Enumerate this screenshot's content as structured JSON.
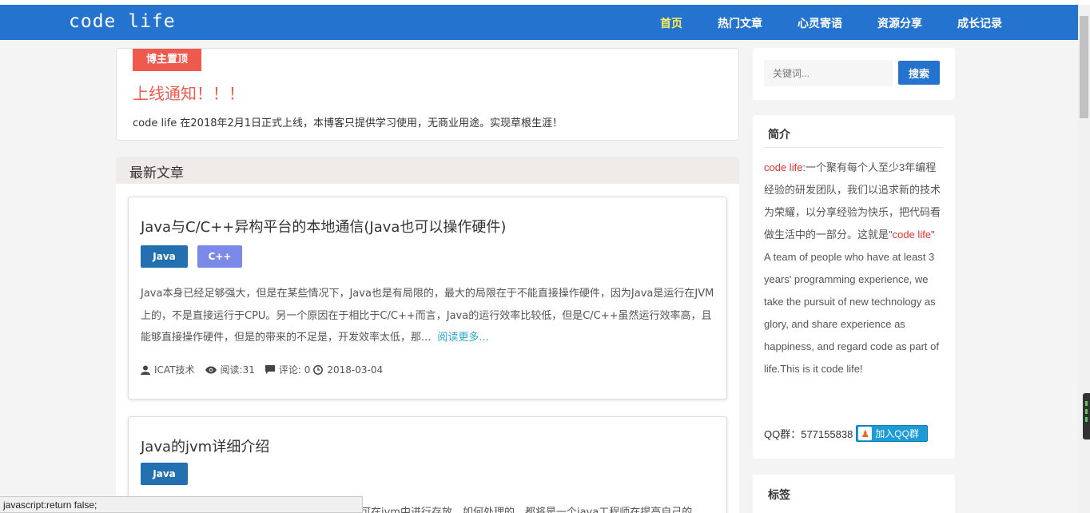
{
  "header": {
    "logo": "code life",
    "nav": [
      {
        "label": "首页",
        "active": true
      },
      {
        "label": "热门文章",
        "active": false
      },
      {
        "label": "心灵寄语",
        "active": false
      },
      {
        "label": "资源分享",
        "active": false
      },
      {
        "label": "成长记录",
        "active": false
      }
    ],
    "colors": {
      "bar": "#2373cf",
      "active": "#ffec5c"
    }
  },
  "pinned": {
    "tag": "博主置顶",
    "title": "上线通知！！！",
    "text": "code life 在2018年2月1日正式上线，本博客只提供学习使用，无商业用途。实现草根生涯！"
  },
  "latest": {
    "heading": "最新文章",
    "posts": [
      {
        "title": "Java与C/C++异构平台的本地通信(Java也可以操作硬件)",
        "tags": [
          "Java",
          "C++"
        ],
        "excerpt": "Java本身已经足够强大，但是在某些情况下，Java也是有局限的，最大的局限在于不能直接操作硬件，因为Java是运行在JVM上的，不是直接运行于CPU。另一个原因在于相比于C/C++而言，Java的运行效率比较低，但是C/C++虽然运行效率高，且能够直接操作硬件，但是的带来的不足是，开发效率太低，那...",
        "read_more": "阅读更多...",
        "author": "ICAT技术",
        "views": "阅读:31",
        "comments": "评论: 0",
        "date": "2018-03-04"
      },
      {
        "title": "Java的jvm详细介绍",
        "tags": [
          "Java"
        ],
        "excerpt_partial": "可在jvm中进行存放，如何处理的，都将是一个java工程师在提高自己的"
      }
    ]
  },
  "sidebar": {
    "search": {
      "placeholder": "关键词...",
      "button": "搜索"
    },
    "intro": {
      "title": "简介",
      "brand": "code life",
      "text_cn": ":一个聚有每个人至少3年编程经验的研发团队，我们以追求新的技术为荣耀，以分享经验为快乐，把代码看做生活中的一部分。这就是\"",
      "brand2": "code life",
      "quote_end": "\"",
      "text_en": "A team of people who have at least 3 years' programming experience, we take the pursuit of new technology as glory, and share experience as happiness, and regard code as part of life.This is it code life!",
      "qq_label": "QQ群：577155838",
      "qq_button": "加入QQ群"
    },
    "tags_title": "标签"
  },
  "statusbar": "javascript:return false;"
}
